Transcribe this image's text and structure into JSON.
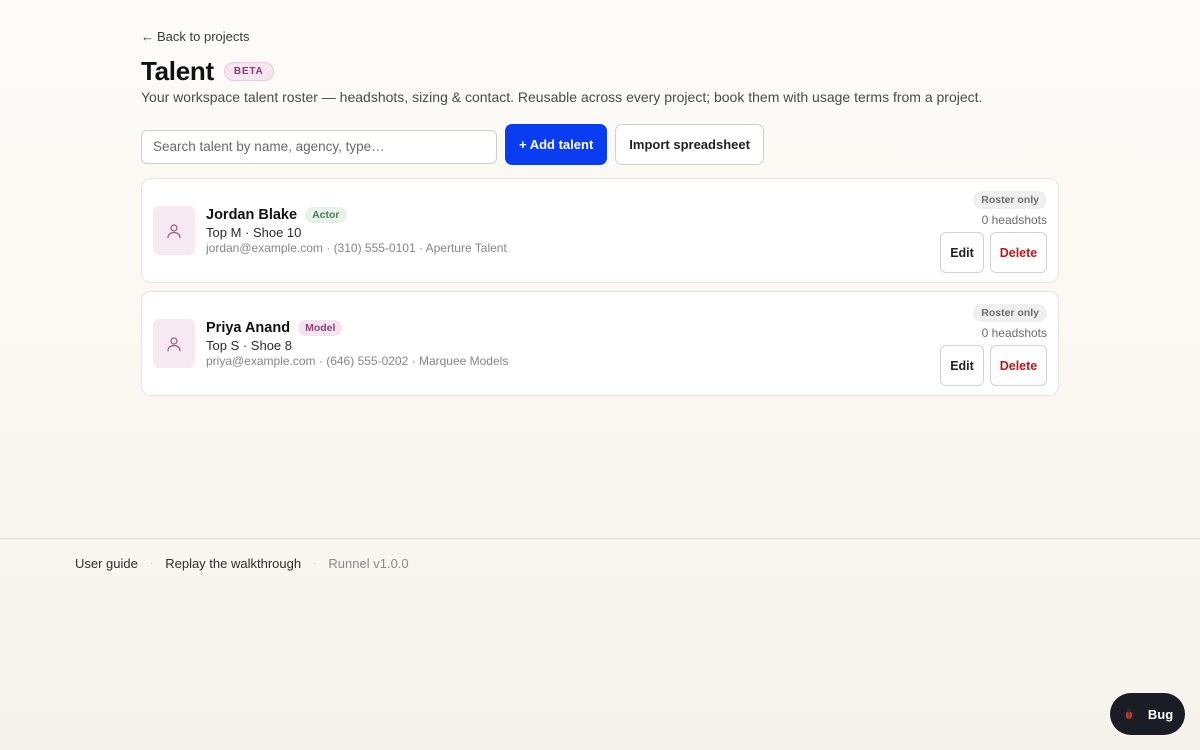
{
  "nav": {
    "back_label": "Back to projects",
    "back_arrow": "←"
  },
  "header": {
    "title": "Talent",
    "badge": "BETA",
    "subtitle": "Your workspace talent roster — headshots, sizing & contact. Reusable across every project; book them with usage terms from a project."
  },
  "toolbar": {
    "search_placeholder": "Search talent by name, agency, type…",
    "search_value": "",
    "add_label": "+ Add talent",
    "import_label": "Import spreadsheet"
  },
  "talent": [
    {
      "name": "Jordan Blake",
      "type": "Actor",
      "sizing": "Top M · Shoe 10",
      "contact": "jordan@example.com · (310) 555-0101 · Aperture Talent",
      "status": "Roster only",
      "headshots": "0 headshots",
      "edit_label": "Edit",
      "delete_label": "Delete"
    },
    {
      "name": "Priya Anand",
      "type": "Model",
      "sizing": "Top S · Shoe 8",
      "contact": "priya@example.com · (646) 555-0202 · Marquee Models",
      "status": "Roster only",
      "headshots": "0 headshots",
      "edit_label": "Edit",
      "delete_label": "Delete"
    }
  ],
  "footer": {
    "links": [
      "User guide",
      "Replay the walkthrough"
    ],
    "separator": "·",
    "version": "Runnel v1.0.0"
  },
  "bug": {
    "label": "Bug",
    "icon": "bug-icon"
  },
  "colors": {
    "accent": "#0a3df2",
    "danger": "#c01818",
    "avatar_bg": "#f6e9f1",
    "actor_badge": "#e8f1ea",
    "model_badge": "#f5e4ef"
  }
}
